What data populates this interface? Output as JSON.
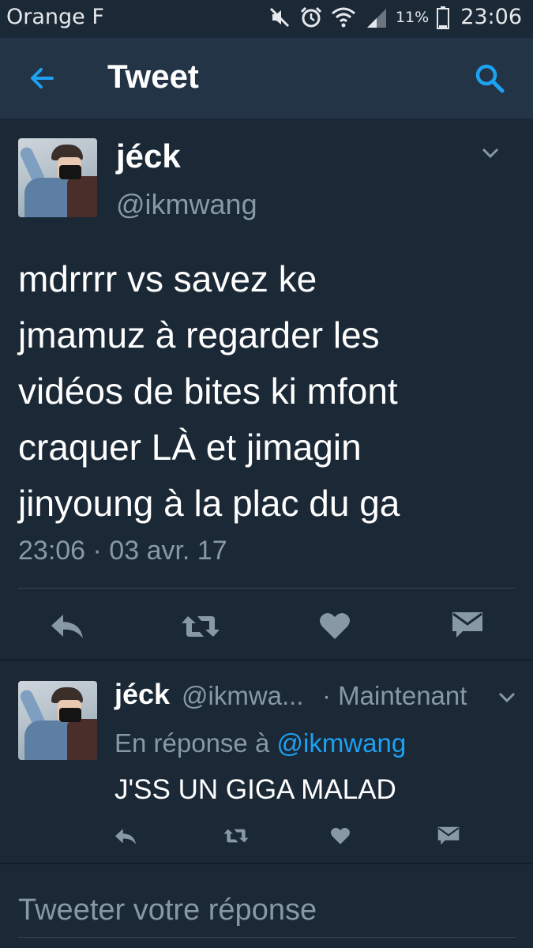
{
  "status_bar": {
    "carrier": "Orange F",
    "battery_percent": "11%",
    "time": "23:06",
    "icons": [
      "mute-icon",
      "alarm-icon",
      "wifi-icon",
      "signal-icon",
      "battery-icon"
    ]
  },
  "header": {
    "title": "Tweet",
    "back_icon": "back-arrow-icon",
    "search_icon": "search-icon"
  },
  "main_tweet": {
    "author_name": "jéck",
    "author_handle": "@ikmwang",
    "text_lines": [
      "mdrrrr vs savez ke",
      "jmamuz à regarder les",
      "vidéos de bites ki mfont",
      "craquer LÀ et jimagin",
      "jinyoung à la plac du ga"
    ],
    "timestamp": "23:06 · 03 avr. 17",
    "actions": [
      "reply-icon",
      "retweet-icon",
      "like-icon",
      "direct-message-icon"
    ]
  },
  "reply_tweet": {
    "author_name": "jéck",
    "author_handle": "@ikmwa...",
    "time": "· Maintenant",
    "in_reply_prefix": "En réponse à",
    "in_reply_handle": "@ikmwang",
    "text": "J'SS UN GIGA MALAD",
    "actions": [
      "reply-icon",
      "retweet-icon",
      "like-icon",
      "direct-message-icon"
    ]
  },
  "compose": {
    "placeholder": "Tweeter votre réponse"
  },
  "colors": {
    "background": "#1b2836",
    "header_bg": "#243447",
    "accent": "#1da1f2",
    "secondary_text": "#8899a6",
    "icon_gray": "#8899a6"
  }
}
